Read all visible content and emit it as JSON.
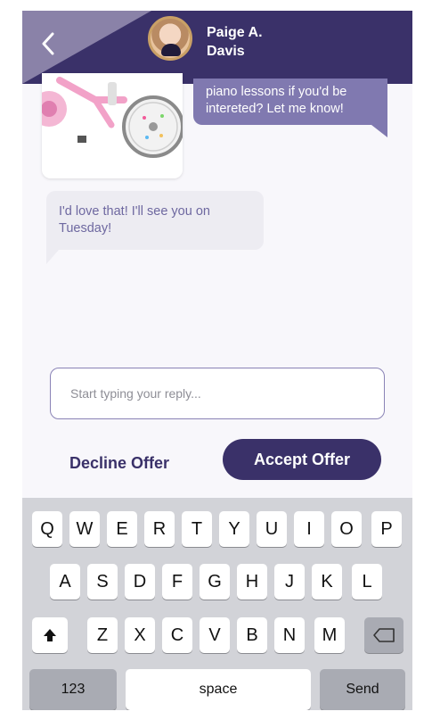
{
  "header": {
    "contact_first": "Paige A.",
    "contact_last": "Davis",
    "back_icon": "chevron-left-icon",
    "avatar_icon": "profile-photo"
  },
  "chat": {
    "outgoing_lines": [
      "piano lessons if you'd be",
      "intereted? Let me know!"
    ],
    "incoming_lines": [
      "I'd love that! I'll see you on",
      "Tuesday!"
    ]
  },
  "reply": {
    "placeholder": "Start typing your reply..."
  },
  "actions": {
    "decline_label": "Decline Offer",
    "accept_label": "Accept Offer"
  },
  "keyboard": {
    "row1": [
      "Q",
      "W",
      "E",
      "R",
      "T",
      "Y",
      "U",
      "I",
      "O",
      "P"
    ],
    "row2": [
      "A",
      "S",
      "D",
      "F",
      "G",
      "H",
      "J",
      "K",
      "L"
    ],
    "row3": [
      "Z",
      "X",
      "C",
      "V",
      "B",
      "N",
      "M"
    ],
    "shift_icon": "shift-arrow-icon",
    "delete_icon": "backspace-icon",
    "numbers_label": "123",
    "space_label": "space",
    "send_label": "Send"
  },
  "colors": {
    "brand": "#3a3169",
    "bubble_out": "#8079b0",
    "bubble_in": "#edecf2"
  }
}
